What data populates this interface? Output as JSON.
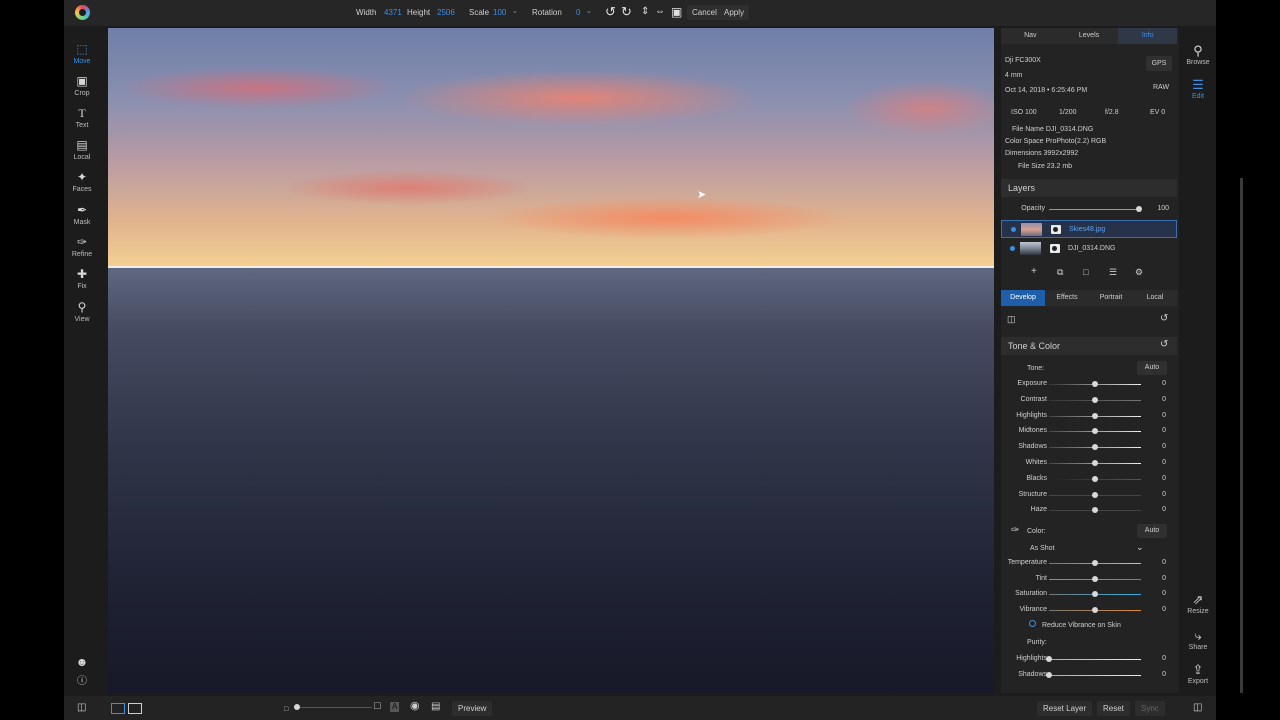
{
  "toolbar": {
    "width_label": "Width",
    "width_value": "4371",
    "height_label": "Height",
    "height_value": "2506",
    "scale_label": "Scale",
    "scale_value": "100",
    "rotation_label": "Rotation",
    "rotation_value": "0",
    "cancel_label": "Cancel",
    "apply_label": "Apply"
  },
  "left_tools": [
    {
      "label": "Move",
      "icon": "move-icon"
    },
    {
      "label": "Crop",
      "icon": "crop-icon"
    },
    {
      "label": "Text",
      "icon": "text-icon"
    },
    {
      "label": "Local",
      "icon": "local-icon"
    },
    {
      "label": "Faces",
      "icon": "faces-icon"
    },
    {
      "label": "Mask",
      "icon": "mask-icon"
    },
    {
      "label": "Refine",
      "icon": "refine-icon"
    },
    {
      "label": "Fix",
      "icon": "fix-icon"
    },
    {
      "label": "View",
      "icon": "view-icon"
    }
  ],
  "right_tools": {
    "browse": "Browse",
    "edit": "Edit",
    "resize": "Resize",
    "share": "Share",
    "export": "Export"
  },
  "info_tabs": [
    "Nav",
    "Levels",
    "Info"
  ],
  "info": {
    "camera": "Dji FC300X",
    "focal": "4 mm",
    "date": "Oct 14, 2018 • 6:25:46 PM",
    "gps": "GPS",
    "raw": "RAW",
    "iso": "ISO 100",
    "shutter": "1/200",
    "aperture": "f/2.8",
    "ev": "EV 0",
    "file_name": "File Name DJI_0314.DNG",
    "color_space": "Color Space ProPhoto(2.2) RGB",
    "dimensions": "Dimensions 3992x2992",
    "file_size": "File Size 23.2 mb"
  },
  "layers": {
    "title": "Layers",
    "opacity_label": "Opacity",
    "opacity_value": "100",
    "items": [
      {
        "name": "Skies48.jpg",
        "selected": true
      },
      {
        "name": "DJI_0314.DNG",
        "selected": false
      }
    ]
  },
  "develop_tabs": [
    "Develop",
    "Effects",
    "Portrait",
    "Local"
  ],
  "tone": {
    "title": "Tone & Color",
    "tone_label": "Tone:",
    "auto_label": "Auto",
    "sliders": [
      {
        "name": "Exposure",
        "value": "0"
      },
      {
        "name": "Contrast",
        "value": "0"
      },
      {
        "name": "Highlights",
        "value": "0"
      },
      {
        "name": "Midtones",
        "value": "0"
      },
      {
        "name": "Shadows",
        "value": "0"
      },
      {
        "name": "Whites",
        "value": "0"
      },
      {
        "name": "Blacks",
        "value": "0"
      },
      {
        "name": "Structure",
        "value": "0"
      },
      {
        "name": "Haze",
        "value": "0"
      }
    ]
  },
  "color": {
    "color_label": "Color:",
    "auto_label": "Auto",
    "preset": "As Shot",
    "sliders": [
      {
        "name": "Temperature",
        "value": "0"
      },
      {
        "name": "Tint",
        "value": "0"
      },
      {
        "name": "Saturation",
        "value": "0"
      },
      {
        "name": "Vibrance",
        "value": "0"
      }
    ],
    "reduce_vibrance": "Reduce Vibrance on Skin",
    "purity_label": "Purity:",
    "purity_sliders": [
      {
        "name": "Highlights",
        "value": "0"
      },
      {
        "name": "Shadows",
        "value": "0"
      }
    ]
  },
  "bottom": {
    "preview": "Preview",
    "reset_layer": "Reset Layer",
    "reset": "Reset",
    "sync": "Sync"
  }
}
